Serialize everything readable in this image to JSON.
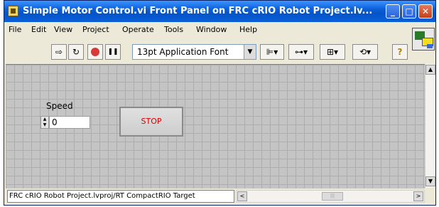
{
  "window": {
    "title": "Simple Motor Control.vi Front Panel on FRC cRIO Robot Project.lv...",
    "minimize": "_",
    "maximize": "□",
    "close": "✕"
  },
  "menu": {
    "items": [
      "File",
      "Edit",
      "View",
      "Project",
      "Operate",
      "Tools",
      "Window",
      "Help"
    ]
  },
  "toolbar": {
    "run_glyph": "⇨",
    "run_continuous_glyph": "↻",
    "pause_glyph": "❚❚",
    "font_select_value": "13pt Application Font",
    "font_select_arrow": "▼",
    "align_glyph": "⊫▾",
    "distribute_glyph": "⊶▾",
    "resize_glyph": "⊞▾",
    "reorder_glyph": "⟲▾",
    "help_glyph": "?"
  },
  "panel": {
    "speed_label": "Speed",
    "speed_value": "0",
    "stop_label": "STOP"
  },
  "statusbar": {
    "context": "FRC cRIO Robot Project.lvproj/RT CompactRIO Target",
    "scroll_left": "<",
    "scroll_right": ">",
    "thumb_grip": "|||"
  },
  "scroll": {
    "up": "▲",
    "down": "▼"
  },
  "colors": {
    "title_bar": "#0a5fd8",
    "stop_text": "#d80000",
    "panel_bg": "#c4c4c4",
    "abort_red": "#d8383a"
  }
}
